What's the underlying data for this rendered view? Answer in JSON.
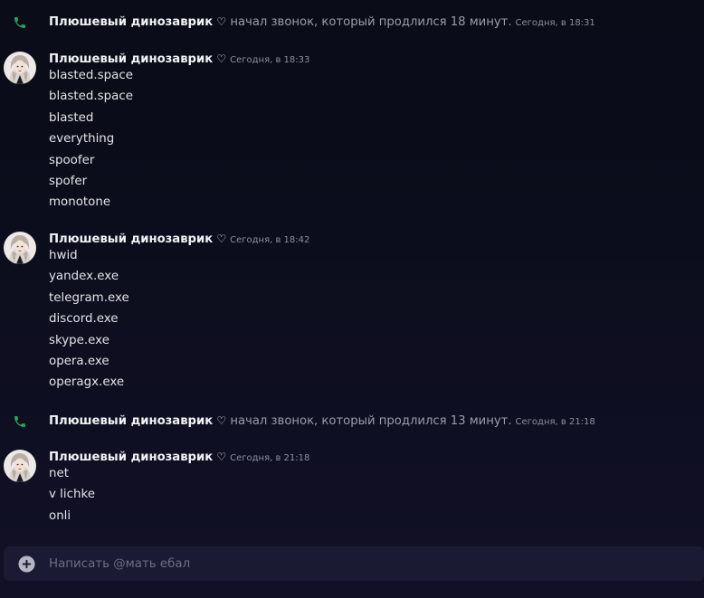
{
  "colors": {
    "background": "#0c0d1c",
    "call_icon": "#23a55a",
    "composer_bg": "#1b1a33"
  },
  "events": [
    {
      "type": "call",
      "icon": "phone-icon",
      "user": "Плюшевый динозаврик",
      "badge": "♡",
      "text": "начал звонок, который продлился 18 минут.",
      "time": "Сегодня, в 18:31"
    },
    {
      "type": "message_group",
      "user": "Плюшевый динозаврик",
      "badge": "♡",
      "time": "Сегодня, в 18:33",
      "lines": [
        "blasted.space",
        "blasted.space",
        "blasted",
        "everything",
        "spoofer",
        "spofer",
        "monotone"
      ]
    },
    {
      "type": "message_group",
      "user": "Плюшевый динозаврик",
      "badge": "♡",
      "time": "Сегодня, в 18:42",
      "lines": [
        "hwid",
        "yandex.exe",
        "telegram.exe",
        "discord.exe",
        "skype.exe",
        "opera.exe",
        "operagx.exe"
      ]
    },
    {
      "type": "call",
      "icon": "phone-icon",
      "user": "Плюшевый динозаврик",
      "badge": "♡",
      "text": "начал звонок, который продлился 13 минут.",
      "time": "Сегодня, в 21:18"
    },
    {
      "type": "message_group",
      "user": "Плюшевый динозаврик",
      "badge": "♡",
      "time": "Сегодня, в 21:18",
      "lines": [
        "net",
        "v lichke",
        "onli"
      ]
    }
  ],
  "composer": {
    "placeholder": "Написать @мать ебал",
    "value": ""
  }
}
